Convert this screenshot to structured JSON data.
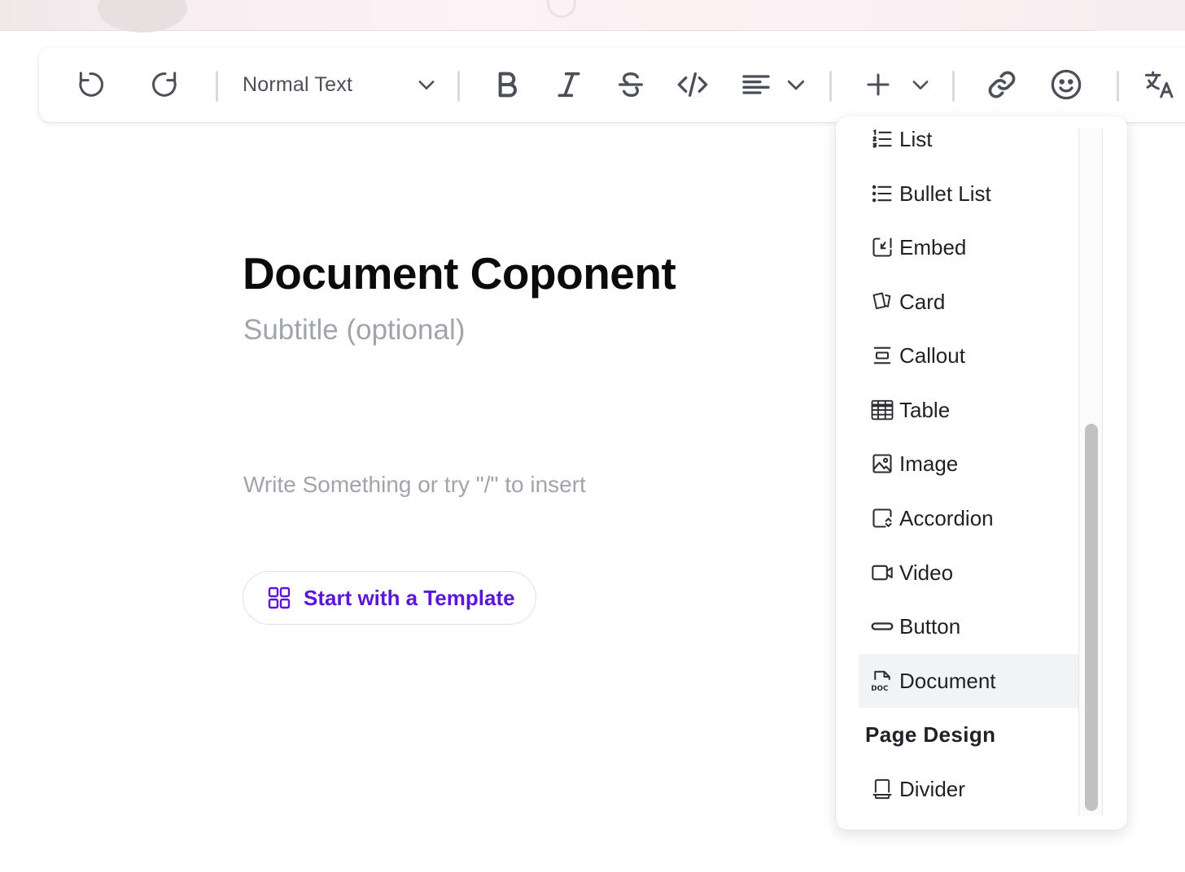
{
  "toolbar": {
    "icons": [
      "undo-icon",
      "redo-icon",
      "bold-icon",
      "italic-icon",
      "strikethrough-icon",
      "code-icon",
      "align-left-icon",
      "plus-icon",
      "link-icon",
      "emoji-icon",
      "translate-icon"
    ],
    "text_style": "Normal Text"
  },
  "document": {
    "title": "Document Coponent",
    "subtitle_placeholder": "Subtitle (optional)",
    "body_placeholder": "Write Something or try \"/\" to insert",
    "template_button": "Start with a Template"
  },
  "insert_menu": {
    "items": [
      {
        "label": "List",
        "icon": "numbered-list-icon"
      },
      {
        "label": "Bullet List",
        "icon": "bullet-list-icon"
      },
      {
        "label": "Embed",
        "icon": "embed-icon"
      },
      {
        "label": "Card",
        "icon": "card-icon"
      },
      {
        "label": "Callout",
        "icon": "callout-icon"
      },
      {
        "label": "Table",
        "icon": "table-icon"
      },
      {
        "label": "Image",
        "icon": "image-icon"
      },
      {
        "label": "Accordion",
        "icon": "accordion-icon"
      },
      {
        "label": "Video",
        "icon": "video-icon"
      },
      {
        "label": "Button",
        "icon": "button-icon"
      },
      {
        "label": "Document",
        "icon": "document-icon",
        "active": true
      }
    ],
    "section_page_design": "Page Design",
    "page_design_items": [
      {
        "label": "Divider",
        "icon": "divider-icon"
      }
    ]
  },
  "colors": {
    "accent": "#5b16d6",
    "text": "#0b0b0c",
    "muted": "#a0a4ab",
    "icon": "#4b4f58",
    "active_row": "#f2f3f5"
  }
}
